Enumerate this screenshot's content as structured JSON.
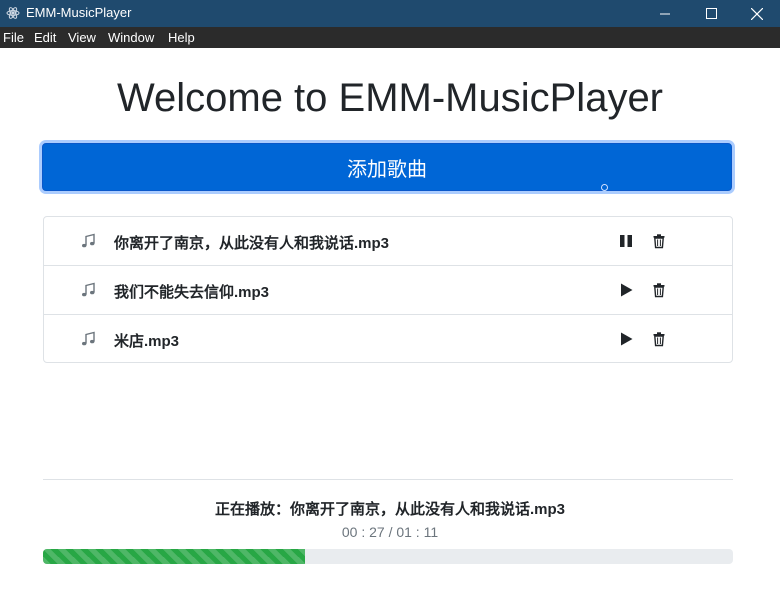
{
  "window": {
    "title": "EMM-MusicPlayer"
  },
  "menu": [
    "File",
    "Edit",
    "View",
    "Window",
    "Help"
  ],
  "main": {
    "heading": "Welcome to EMM-MusicPlayer",
    "add_button_label": "添加歌曲"
  },
  "songs": [
    {
      "name": "你离开了南京，从此没有人和我说话.mp3",
      "state": "playing"
    },
    {
      "name": "我们不能失去信仰.mp3",
      "state": "stopped"
    },
    {
      "name": "米店.mp3",
      "state": "stopped"
    }
  ],
  "player": {
    "now_playing": "正在播放：你离开了南京，从此没有人和我说话.mp3",
    "time": "00 : 27 / 01 : 11",
    "progress_fraction": 0.38
  },
  "colors": {
    "titlebar": "#1f4a6e",
    "menubar": "#2b2b2b",
    "primary": "#0066d6",
    "progress": "#28a745"
  },
  "icons": {
    "song": "music-note-icon",
    "pause": "pause-icon",
    "play": "play-icon",
    "delete": "trash-icon"
  }
}
